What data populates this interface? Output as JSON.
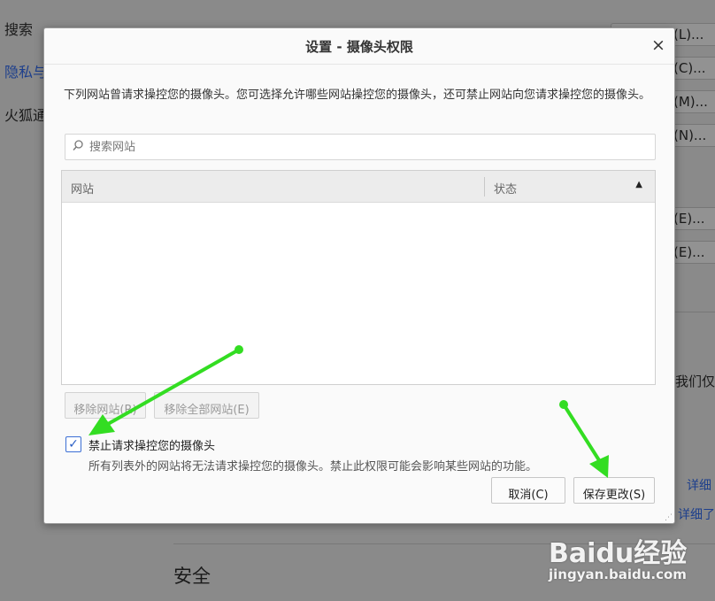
{
  "background": {
    "sidebar": {
      "search": "搜索",
      "privacy": "隐私与",
      "firefox_account": "火狐通"
    },
    "right_buttons": [
      "(L)...",
      "(C)...",
      "(M)...",
      "(N)...",
      "(E)...",
      "(E)..."
    ],
    "right_text": "我们仅",
    "right_links": [
      "详细",
      "详细了"
    ],
    "section_heading": "安全"
  },
  "dialog": {
    "title": "设置 - 摄像头权限",
    "close_glyph": "×",
    "description": "下列网站曾请求操控您的摄像头。您可选择允许哪些网站操控您的摄像头，还可禁止网站向您请求操控您的摄像头。",
    "search": {
      "icon": "search-icon",
      "placeholder": "搜索网站"
    },
    "table": {
      "columns": [
        "网站",
        "状态"
      ],
      "sort_glyph": "▲",
      "rows": []
    },
    "remove_site_label": "移除网站(R)",
    "remove_all_label": "移除全部网站(E)",
    "block_checkbox": {
      "checked": true,
      "glyph": "✓",
      "label": "禁止请求操控您的摄像头",
      "note": "所有列表外的网站将无法请求操控您的摄像头。禁止此权限可能会影响某些网站的功能。"
    },
    "cancel_label": "取消(C)",
    "save_label": "保存更改(S)",
    "resize_glyph": "⋰"
  },
  "watermark": {
    "logo": "Baidu经验",
    "url": "jingyan.baidu.com"
  },
  "colors": {
    "annotation_arrow": "#33dd22",
    "checkbox_accent": "#2a5fc6",
    "overlay_gray": "#8a8a8a"
  }
}
